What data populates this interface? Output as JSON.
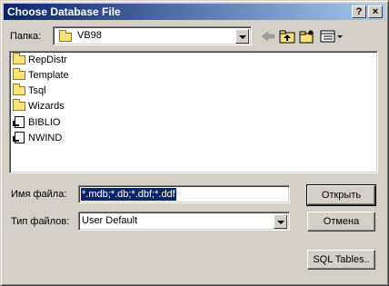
{
  "window": {
    "title": "Choose Database File"
  },
  "titlebar_buttons": {
    "help": "?",
    "close": "×"
  },
  "location": {
    "label": "Папка:",
    "value": "VB98"
  },
  "files": [
    {
      "name": "RepDistr",
      "type": "folder"
    },
    {
      "name": "Template",
      "type": "folder"
    },
    {
      "name": "Tsql",
      "type": "folder"
    },
    {
      "name": "Wizards",
      "type": "folder"
    },
    {
      "name": "BIBLIO",
      "type": "shortcut"
    },
    {
      "name": "NWIND",
      "type": "shortcut"
    }
  ],
  "filename": {
    "label": "Имя файла:",
    "value": "*.mdb;*.db;*.dbf;*.ddf"
  },
  "filetype": {
    "label": "Тип файлов:",
    "value": "User Default"
  },
  "buttons": {
    "open": "Открыть",
    "cancel": "Отмена",
    "sql_tables": "SQL Tables.."
  },
  "toolbar_icons": [
    "back-arrow-icon",
    "up-folder-icon",
    "new-folder-icon",
    "view-menu-icon"
  ],
  "colors": {
    "title_start": "#0a246a",
    "title_end": "#a6caf0",
    "selection": "#0a246a",
    "face": "#d4d0c8"
  }
}
